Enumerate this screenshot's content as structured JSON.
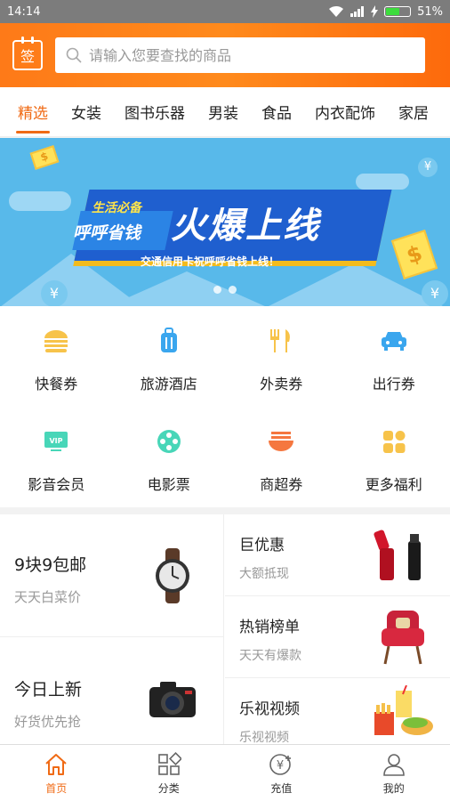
{
  "status_bar": {
    "time": "14:14",
    "battery": "51%"
  },
  "header": {
    "sign_label": "签",
    "search_placeholder": "请输入您要查找的商品"
  },
  "tabs": [
    {
      "label": "精选",
      "active": true
    },
    {
      "label": "女装"
    },
    {
      "label": "图书乐器"
    },
    {
      "label": "男装"
    },
    {
      "label": "食品"
    },
    {
      "label": "内衣配饰"
    },
    {
      "label": "家居"
    }
  ],
  "banner": {
    "tag_line1": "生活必备",
    "tag_line2": "呼呼省钱",
    "headline": "火爆上线",
    "caption": "交通信用卡祝呼呼省钱上线！"
  },
  "grid": [
    {
      "label": "快餐券",
      "icon": "burger-icon",
      "color": "#f7c34a"
    },
    {
      "label": "旅游酒店",
      "icon": "luggage-icon",
      "color": "#3aa6ee"
    },
    {
      "label": "外卖券",
      "icon": "fork-knife-icon",
      "color": "#f7c34a"
    },
    {
      "label": "出行券",
      "icon": "car-icon",
      "color": "#3aa6ee"
    },
    {
      "label": "影音会员",
      "icon": "vip-icon",
      "color": "#48d6b8"
    },
    {
      "label": "电影票",
      "icon": "film-reel-icon",
      "color": "#48d6b8"
    },
    {
      "label": "商超券",
      "icon": "bowl-icon",
      "color": "#f5773f"
    },
    {
      "label": "更多福利",
      "icon": "more-grid-icon",
      "color": "#f7c34a"
    }
  ],
  "promos": {
    "left": [
      {
        "title": "9块9包邮",
        "subtitle": "天天白菜价"
      },
      {
        "title": "今日上新",
        "subtitle": "好货优先抢"
      }
    ],
    "right": [
      {
        "title": "巨优惠",
        "subtitle": "大额抵现"
      },
      {
        "title": "热销榜单",
        "subtitle": "天天有爆款"
      },
      {
        "title": "乐视视频",
        "subtitle": "乐视视频"
      }
    ]
  },
  "bottom_nav": [
    {
      "label": "首页",
      "icon": "home-icon",
      "active": true
    },
    {
      "label": "分类",
      "icon": "category-icon"
    },
    {
      "label": "充值",
      "icon": "recharge-icon"
    },
    {
      "label": "我的",
      "icon": "profile-icon"
    }
  ],
  "colors": {
    "accent": "#f06a14",
    "header": "#ff8a1c",
    "banner": "#58b9ea"
  }
}
